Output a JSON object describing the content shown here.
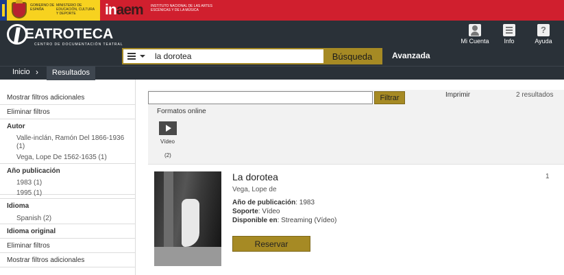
{
  "gov": {
    "gobierno": "GOBIERNO DE ESPAÑA",
    "ministerio": "MINISTERIO DE EDUCACIÓN, CULTURA Y DEPORTE",
    "inaem_prefix": "in",
    "inaem_suffix": "aem",
    "inaem_full": "INSTITUTO NACIONAL DE LAS ARTES ESCÉNICAS Y DE LA MÚSICA"
  },
  "header": {
    "logo_title": "EATROTECA",
    "logo_subtitle": "CENTRO DE DOCUMENTACIÓN TEATRAL",
    "links": [
      {
        "label": "Mi Cuenta",
        "icon": "user-icon"
      },
      {
        "label": "Info",
        "icon": "info-icon"
      },
      {
        "label": "Ayuda",
        "icon": "help-icon",
        "glyph": "?"
      }
    ]
  },
  "search": {
    "value": "la dorotea",
    "button": "Búsqueda",
    "advanced": "Avanzada"
  },
  "breadcrumb": {
    "home": "Inicio",
    "separator": "›",
    "current": "Resultados"
  },
  "sidebar": {
    "show_more_top": "Mostrar filtros adicionales",
    "clear_top": "Eliminar filtros",
    "autor_label": "Autor",
    "autor_items": [
      "Valle-inclán, Ramón Del 1866-1936 (1)",
      "Vega, Lope De 1562-1635 (1)"
    ],
    "year_label": "Año publicación",
    "year_items": [
      "1983 (1)",
      "1995 (1)"
    ],
    "lang_label": "Idioma",
    "lang_items": [
      "Spanish (2)"
    ],
    "orig_lang_label": "Idioma original",
    "clear_bottom": "Eliminar filtros",
    "show_more_bottom": "Mostrar filtros adicionales"
  },
  "results": {
    "filter_button": "Filtrar",
    "print": "Imprimir",
    "count": "2 resultados",
    "formats_label": "Formatos online",
    "format_name": "Vídeo",
    "format_count": "(2)"
  },
  "item": {
    "title": "La dorotea",
    "author": "Vega, Lope de",
    "year_label": "Año de publicación",
    "year": "1983",
    "support_label": "Soporte",
    "support": "Vídeo",
    "available_label": "Disponible en",
    "available": "Streaming (Vídeo)",
    "reserve_button": "Reservar",
    "index": "1"
  },
  "colors": {
    "gov_red": "#d01f2e",
    "gov_yellow": "#f7d21f",
    "header_dark": "#2a3138",
    "accent_gold": "#a68a24"
  }
}
